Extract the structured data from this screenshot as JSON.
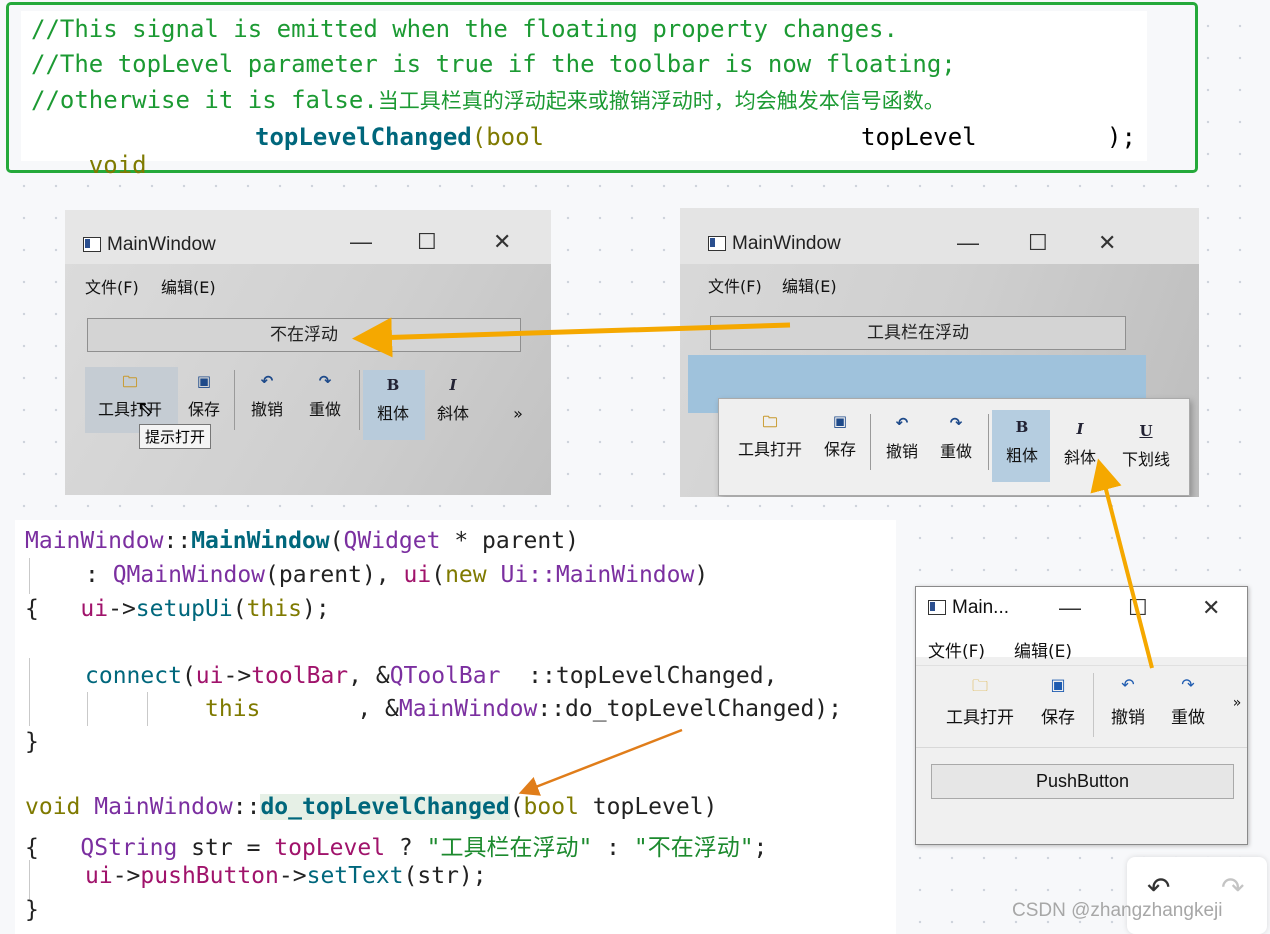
{
  "top_note": {
    "line1": "//This signal is emitted when the floating property changes.",
    "line2": "//The topLevel parameter is true if the toolbar is now floating;",
    "line3_en": "//otherwise it is false.",
    "line3_cn": "当工具栏真的浮动起来或撤销浮动时，均会触发本信号函数。",
    "decl_void": "void",
    "decl_fn": "topLevelChanged",
    "decl_open": "(bool",
    "decl_param": "topLevel",
    "decl_close": ");"
  },
  "photo_left": {
    "title": "MainWindow",
    "menu_file": "文件(F)",
    "menu_edit": "编辑(E)",
    "button_text": "不在浮动",
    "tools": [
      "工具打开",
      "保存",
      "撤销",
      "重做",
      "粗体",
      "斜体"
    ],
    "tool_icons": [
      "folder-icon",
      "save-icon",
      "undo-icon",
      "redo-icon",
      "bold-icon",
      "italic-icon"
    ],
    "tooltip": "提示打开",
    "overflow": "»"
  },
  "photo_right": {
    "title": "MainWindow",
    "menu_file": "文件(F)",
    "menu_edit": "编辑(E)",
    "button_text": "工具栏在浮动",
    "tools": [
      "工具打开",
      "保存",
      "撤销",
      "重做",
      "粗体",
      "斜体",
      "下划线"
    ],
    "tool_icons": [
      "folder-icon",
      "save-icon",
      "undo-icon",
      "redo-icon",
      "bold-icon",
      "italic-icon",
      "underline-icon"
    ]
  },
  "code": {
    "l1": {
      "a": "MainWindow",
      "b": "::",
      "c": "MainWindow",
      "d": "(",
      "e": "QWidget",
      "f": " * parent)"
    },
    "l2": {
      "a": ": ",
      "b": "QMainWindow",
      "c": "(parent), ",
      "d": "ui",
      "e": "(",
      "f": "new",
      "g": " ",
      "h": "Ui::MainWindow",
      "i": ")"
    },
    "l3": {
      "a": "{   ",
      "b": "ui",
      "c": "->",
      "d": "setupUi",
      "e": "(",
      "f": "this",
      "g": ");"
    },
    "l4": {
      "a": "connect",
      "b": "(",
      "c": "ui",
      "d": "->",
      "e": "toolBar",
      "f": ", &",
      "g": "QToolBar",
      "h": "  ::topLevelChanged,"
    },
    "l5": {
      "a": "this",
      "b": "       , &",
      "c": "MainWindow",
      "d": "::do_topLevelChanged);"
    },
    "l6": "}",
    "l7": {
      "a": "void",
      "b": " ",
      "c": "MainWindow",
      "d": "::",
      "e": "do_topLevelChanged",
      "f": "(",
      "g": "bool",
      "h": " topLevel)"
    },
    "l8": {
      "a": "{   ",
      "b": "QString",
      "c": " str = ",
      "d": "topLevel",
      "e": " ? ",
      "f": "\"工具栏在浮动\"",
      "g": " : ",
      "h": "\"不在浮动\"",
      "i": ";"
    },
    "l9": {
      "a": "ui",
      "b": "->",
      "c": "pushButton",
      "d": "->",
      "e": "setText",
      "f": "(str);"
    },
    "l10": "}"
  },
  "small_window": {
    "title": "Main...",
    "menu_file": "文件(F)",
    "menu_edit": "编辑(E)",
    "tools": [
      "工具打开",
      "保存",
      "撤销",
      "重做"
    ],
    "tool_icons": [
      "folder-icon",
      "save-icon",
      "undo-icon",
      "redo-icon"
    ],
    "overflow": "»",
    "push_button": "PushButton"
  },
  "watermark": "CSDN @zhangzhangkeji",
  "colors": {
    "green_border": "#25a93a",
    "arrow_orange": "#f5a800",
    "arrow_orange2": "#e07d1a",
    "comment_green": "#1c9a33"
  }
}
